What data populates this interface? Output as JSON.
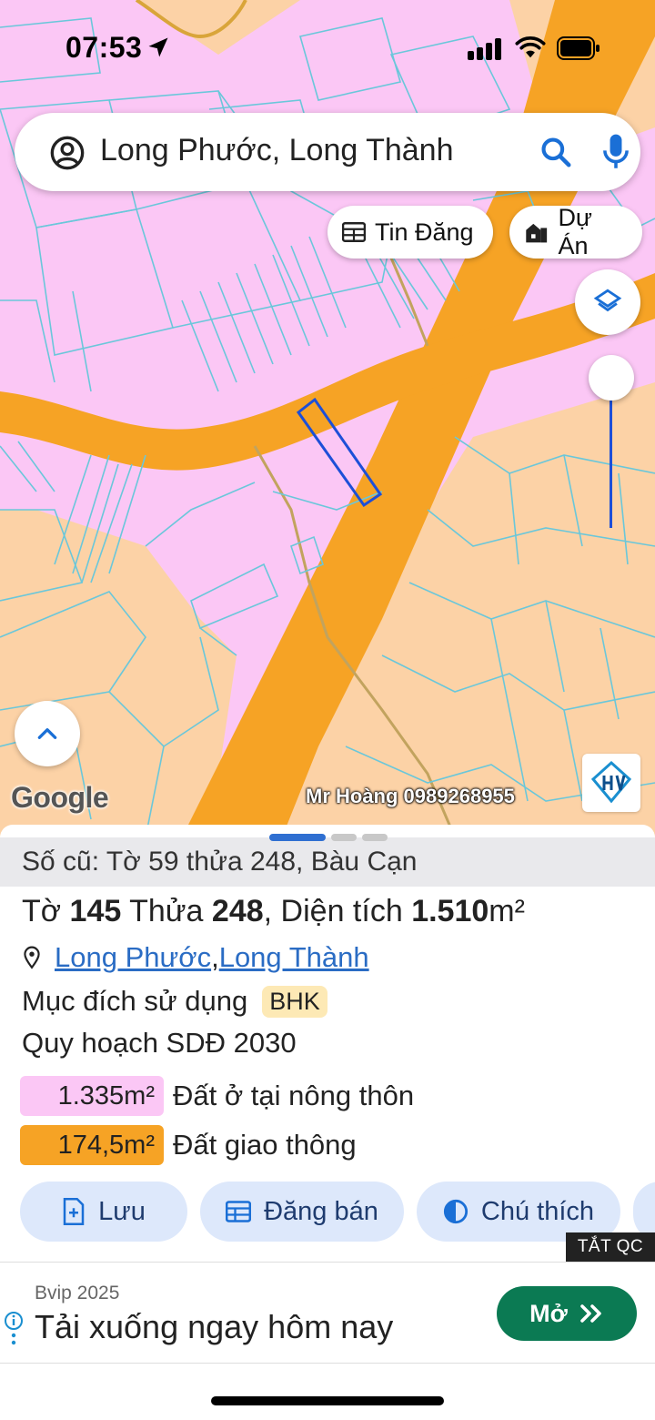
{
  "status_bar": {
    "time": "07:53"
  },
  "search": {
    "query": "Long Phước, Long Thành"
  },
  "map_chips": {
    "tin_dang": "Tin Đăng",
    "du_an": "Dự Án"
  },
  "map": {
    "google_label": "Google",
    "watermark": "Mr Hoàng 0989268955",
    "land_colors": {
      "residential": "#fbc7f5",
      "agricultural": "#fcd2a6",
      "traffic": "#f6a325",
      "boundary": "#6ac7da",
      "selected": "#1d4fd8"
    }
  },
  "sheet": {
    "old_ref": "Số cũ: Tờ 59 thửa 248, Bàu Cạn",
    "plot": {
      "to_label": "Tờ",
      "to_value": "145",
      "thua_label": "Thửa",
      "thua_value": "248",
      "area_label": ", Diện tích",
      "area_value": "1.510",
      "area_unit": "m²"
    },
    "location": {
      "ward": "Long Phước",
      "sep": ", ",
      "district": "Long Thành"
    },
    "purpose": {
      "label": "Mục đích sử dụng",
      "code": "BHK"
    },
    "plan_title": "Quy hoạch SDĐ 2030",
    "areas": [
      {
        "value": "1.335m²",
        "label": "Đất ở tại nông thôn",
        "color": "#fbc7f5"
      },
      {
        "value": "174,5m²",
        "label": "Đất giao thông",
        "color": "#f6a325"
      }
    ],
    "actions": {
      "save": "Lưu",
      "post": "Đăng bán",
      "legend": "Chú thích"
    },
    "ads_off": "TẮT QC"
  },
  "ad": {
    "sponsor": "Bvip 2025",
    "headline": "Tải xuống ngay hôm nay",
    "cta": "Mở"
  }
}
